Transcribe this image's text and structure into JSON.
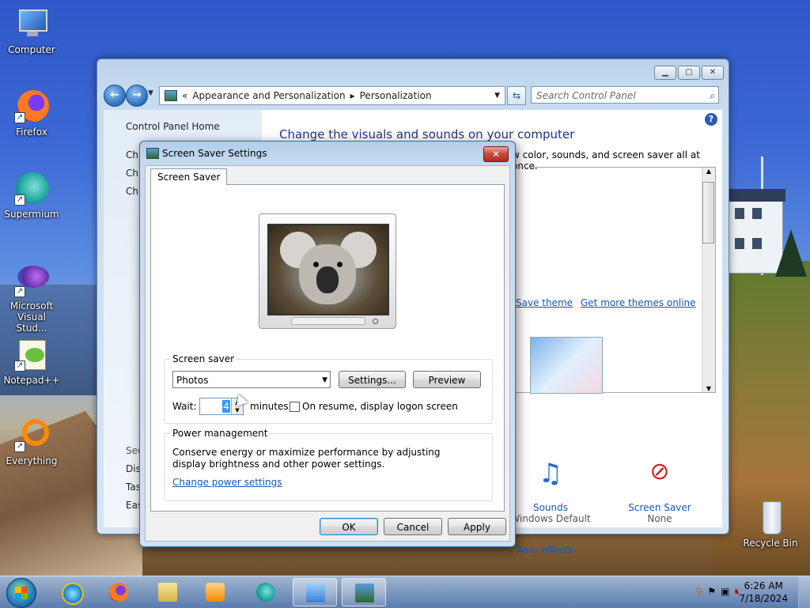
{
  "desktop": {
    "icons": [
      {
        "label": "Computer"
      },
      {
        "label": "Firefox"
      },
      {
        "label": "Supermium"
      },
      {
        "label": "Microsoft Visual Stud..."
      },
      {
        "label": "Notepad++"
      },
      {
        "label": "Everything"
      },
      {
        "label": "Recycle Bin"
      }
    ]
  },
  "control_panel": {
    "address_prefix": "«",
    "breadcrumb": [
      "Appearance and Personalization",
      "Personalization"
    ],
    "search_placeholder": "Search Control Panel",
    "left": {
      "home": "Control Panel Home",
      "fragments_top": [
        "Ch",
        "Ch",
        "Ch"
      ],
      "fragments_bottom": [
        "See",
        "Dis",
        "Tas",
        "Eas"
      ]
    },
    "main": {
      "title": "Change the visuals and sounds on your computer",
      "subtitle": "w color, sounds, and screen saver all at once.",
      "save_theme": "Save theme",
      "get_more": "Get more themes online",
      "sounds_label": "Sounds",
      "sounds_sub": "Windows Default",
      "screensaver_label": "Screen Saver",
      "screensaver_sub": "None",
      "aero": "Aero effects"
    }
  },
  "dialog": {
    "title": "Screen Saver Settings",
    "tab": "Screen Saver",
    "screen_saver_group": "Screen saver",
    "selected_saver": "Photos",
    "settings_btn": "Settings...",
    "preview_btn": "Preview",
    "wait_label": "Wait:",
    "wait_value": "4",
    "minutes_label": "minutes",
    "resume_label": "On resume, display logon screen",
    "resume_checked": false,
    "power_group": "Power management",
    "power_text": "Conserve energy or maximize performance by adjusting display brightness and other power settings.",
    "power_link": "Change power settings",
    "ok": "OK",
    "cancel": "Cancel",
    "apply": "Apply"
  },
  "taskbar": {
    "time": "6:26 AM",
    "date": "7/18/2024"
  },
  "colors": {
    "link": "#1a56b0",
    "title_blue": "#1e3287",
    "close_red": "#c7463a"
  }
}
